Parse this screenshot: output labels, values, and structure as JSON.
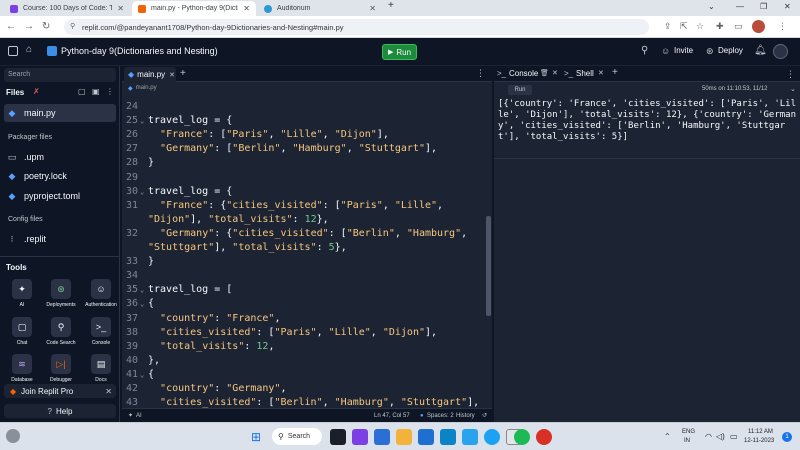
{
  "browser": {
    "tabs": [
      {
        "title": "Course: 100 Days of Code: The C",
        "color": "#7b3fe4"
      },
      {
        "title": "main.py - Python-day 9(Diction",
        "color": "#f26207"
      },
      {
        "title": "Auditorium",
        "color": "#2b9ad1"
      }
    ],
    "new_tab": "+",
    "url": "replit.com/@pandeyanant1708/Python-day-9Dictionaries-and-Nesting#main.py"
  },
  "header": {
    "repl_name": "Python-day 9(Dictionaries and Nesting)",
    "run_label": "Run",
    "invite_label": "Invite",
    "deploy_label": "Deploy"
  },
  "sidebar": {
    "search_placeholder": "Search",
    "files_label": "Files",
    "files": [
      {
        "name": "main.py"
      }
    ],
    "packager_label": "Packager files",
    "packager_files": [
      {
        "name": ".upm"
      },
      {
        "name": "poetry.lock"
      },
      {
        "name": "pyproject.toml"
      }
    ],
    "config_label": "Config files",
    "config_files": [
      {
        "name": ".replit"
      }
    ],
    "tools_label": "Tools",
    "tools": [
      {
        "name": "AI",
        "icon": "ai-icon"
      },
      {
        "name": "Deployments",
        "icon": "deployments-icon"
      },
      {
        "name": "Authentication",
        "icon": "authentication-icon"
      },
      {
        "name": "Chat",
        "icon": "chat-icon"
      },
      {
        "name": "Code Search",
        "icon": "code-search-icon"
      },
      {
        "name": "Console",
        "icon": "console-icon"
      },
      {
        "name": "Database",
        "icon": "database-icon"
      },
      {
        "name": "Debugger",
        "icon": "debugger-icon"
      },
      {
        "name": "Docs",
        "icon": "docs-icon"
      }
    ],
    "join_pro_label": "Join Replit Pro",
    "help_label": "Help"
  },
  "editor": {
    "tab_label": "main.py",
    "breadcrumb": "main.py",
    "lines": [
      {
        "num": "24",
        "fold": "",
        "tokens": [
          {
            "t": "",
            "c": "cb"
          }
        ]
      },
      {
        "num": "25",
        "fold": "⌄",
        "tokens": [
          {
            "t": "travel_log = {",
            "c": "cb"
          }
        ]
      },
      {
        "num": "26",
        "fold": "",
        "tokens": [
          {
            "t": "  ",
            "c": "cb"
          },
          {
            "t": "\"France\"",
            "c": "ks"
          },
          {
            "t": ": [",
            "c": "cb"
          },
          {
            "t": "\"Paris\"",
            "c": "ks"
          },
          {
            "t": ", ",
            "c": "cb"
          },
          {
            "t": "\"Lille\"",
            "c": "ks"
          },
          {
            "t": ", ",
            "c": "cb"
          },
          {
            "t": "\"Dijon\"",
            "c": "ks"
          },
          {
            "t": "],",
            "c": "cb"
          }
        ]
      },
      {
        "num": "27",
        "fold": "",
        "tokens": [
          {
            "t": "  ",
            "c": "cb"
          },
          {
            "t": "\"Germany\"",
            "c": "ks"
          },
          {
            "t": ": [",
            "c": "cb"
          },
          {
            "t": "\"Berlin\"",
            "c": "ks"
          },
          {
            "t": ", ",
            "c": "cb"
          },
          {
            "t": "\"Hamburg\"",
            "c": "ks"
          },
          {
            "t": ", ",
            "c": "cb"
          },
          {
            "t": "\"Stuttgart\"",
            "c": "ks"
          },
          {
            "t": "],",
            "c": "cb"
          }
        ]
      },
      {
        "num": "28",
        "fold": "",
        "tokens": [
          {
            "t": "}",
            "c": "cb"
          }
        ]
      },
      {
        "num": "29",
        "fold": "",
        "tokens": [
          {
            "t": "",
            "c": "cb"
          }
        ]
      },
      {
        "num": "30",
        "fold": "⌄",
        "tokens": [
          {
            "t": "travel_log = {",
            "c": "cb"
          }
        ]
      },
      {
        "num": "31",
        "fold": "",
        "tokens": [
          {
            "t": "  ",
            "c": "cb"
          },
          {
            "t": "\"France\"",
            "c": "ks"
          },
          {
            "t": ": {",
            "c": "cb"
          },
          {
            "t": "\"cities_visited\"",
            "c": "ks"
          },
          {
            "t": ": [",
            "c": "cb"
          },
          {
            "t": "\"Paris\"",
            "c": "ks"
          },
          {
            "t": ", ",
            "c": "cb"
          },
          {
            "t": "\"Lille\"",
            "c": "ks"
          },
          {
            "t": ",",
            "c": "cb"
          }
        ]
      },
      {
        "num": "",
        "fold": "",
        "tokens": [
          {
            "t": "\"Dijon\"",
            "c": "ks"
          },
          {
            "t": "], ",
            "c": "cb"
          },
          {
            "t": "\"total_visits\"",
            "c": "ks"
          },
          {
            "t": ": ",
            "c": "cb"
          },
          {
            "t": "12",
            "c": "nm"
          },
          {
            "t": "},",
            "c": "cb"
          }
        ]
      },
      {
        "num": "32",
        "fold": "",
        "tokens": [
          {
            "t": "  ",
            "c": "cb"
          },
          {
            "t": "\"Germany\"",
            "c": "ks"
          },
          {
            "t": ": {",
            "c": "cb"
          },
          {
            "t": "\"cities_visited\"",
            "c": "ks"
          },
          {
            "t": ": [",
            "c": "cb"
          },
          {
            "t": "\"Berlin\"",
            "c": "ks"
          },
          {
            "t": ", ",
            "c": "cb"
          },
          {
            "t": "\"Hamburg\"",
            "c": "ks"
          },
          {
            "t": ",",
            "c": "cb"
          }
        ]
      },
      {
        "num": "",
        "fold": "",
        "tokens": [
          {
            "t": "\"Stuttgart\"",
            "c": "ks"
          },
          {
            "t": "], ",
            "c": "cb"
          },
          {
            "t": "\"total_visits\"",
            "c": "ks"
          },
          {
            "t": ": ",
            "c": "cb"
          },
          {
            "t": "5",
            "c": "nm"
          },
          {
            "t": "},",
            "c": "cb"
          }
        ]
      },
      {
        "num": "33",
        "fold": "",
        "tokens": [
          {
            "t": "}",
            "c": "cb"
          }
        ]
      },
      {
        "num": "34",
        "fold": "",
        "tokens": [
          {
            "t": "",
            "c": "cb"
          }
        ]
      },
      {
        "num": "35",
        "fold": "⌄",
        "tokens": [
          {
            "t": "travel_log = [",
            "c": "cb"
          }
        ]
      },
      {
        "num": "36",
        "fold": "⌄",
        "tokens": [
          {
            "t": "{",
            "c": "cb"
          }
        ]
      },
      {
        "num": "37",
        "fold": "",
        "tokens": [
          {
            "t": "  ",
            "c": "cb"
          },
          {
            "t": "\"country\"",
            "c": "ks"
          },
          {
            "t": ": ",
            "c": "cb"
          },
          {
            "t": "\"France\"",
            "c": "ks"
          },
          {
            "t": ",",
            "c": "cb"
          }
        ]
      },
      {
        "num": "38",
        "fold": "",
        "tokens": [
          {
            "t": "  ",
            "c": "cb"
          },
          {
            "t": "\"cities_visited\"",
            "c": "ks"
          },
          {
            "t": ": [",
            "c": "cb"
          },
          {
            "t": "\"Paris\"",
            "c": "ks"
          },
          {
            "t": ", ",
            "c": "cb"
          },
          {
            "t": "\"Lille\"",
            "c": "ks"
          },
          {
            "t": ", ",
            "c": "cb"
          },
          {
            "t": "\"Dijon\"",
            "c": "ks"
          },
          {
            "t": "],",
            "c": "cb"
          }
        ]
      },
      {
        "num": "39",
        "fold": "",
        "tokens": [
          {
            "t": "  ",
            "c": "cb"
          },
          {
            "t": "\"total_visits\"",
            "c": "ks"
          },
          {
            "t": ": ",
            "c": "cb"
          },
          {
            "t": "12",
            "c": "nm"
          },
          {
            "t": ",",
            "c": "cb"
          }
        ]
      },
      {
        "num": "40",
        "fold": "",
        "tokens": [
          {
            "t": "},",
            "c": "cb"
          }
        ]
      },
      {
        "num": "41",
        "fold": "⌄",
        "tokens": [
          {
            "t": "{",
            "c": "cb"
          }
        ]
      },
      {
        "num": "42",
        "fold": "",
        "tokens": [
          {
            "t": "  ",
            "c": "cb"
          },
          {
            "t": "\"country\"",
            "c": "ks"
          },
          {
            "t": ": ",
            "c": "cb"
          },
          {
            "t": "\"Germany\"",
            "c": "ks"
          },
          {
            "t": ",",
            "c": "cb"
          }
        ]
      },
      {
        "num": "43",
        "fold": "",
        "tokens": [
          {
            "t": "  ",
            "c": "cb"
          },
          {
            "t": "\"cities_visited\"",
            "c": "ks"
          },
          {
            "t": ": [",
            "c": "cb"
          },
          {
            "t": "\"Berlin\"",
            "c": "ks"
          },
          {
            "t": ", ",
            "c": "cb"
          },
          {
            "t": "\"Hamburg\"",
            "c": "ks"
          },
          {
            "t": ", ",
            "c": "cb"
          },
          {
            "t": "\"Stuttgart\"",
            "c": "ks"
          },
          {
            "t": "],",
            "c": "cb"
          }
        ]
      }
    ],
    "status": {
      "ai_label": "AI",
      "position": "Ln 47, Col 57",
      "spaces": "Spaces: 2",
      "history": "History"
    }
  },
  "console": {
    "tab_console": "Console",
    "tab_shell": "Shell",
    "run_badge": "Run",
    "run_meta": "50ms on 11:10:53, 11/12",
    "output": "[{'country': 'France', 'cities_visited': ['Paris', 'Lille', 'Dijon'], 'total_visits': 12}, {'country': 'Germany', 'cities_visited': ['Berlin', 'Hamburg', 'Stuttgart'], 'total_visits': 5}]"
  },
  "taskbar": {
    "search_label": "Search",
    "lang_top": "ENG",
    "lang_bottom": "IN",
    "time": "11:12 AM",
    "date": "12-11-2023",
    "notification_count": "1"
  },
  "colors": {
    "bg": "#0e1525",
    "panel": "#1c2333",
    "run_green": "#1e8a3c",
    "accent_blue": "#0079f2"
  }
}
